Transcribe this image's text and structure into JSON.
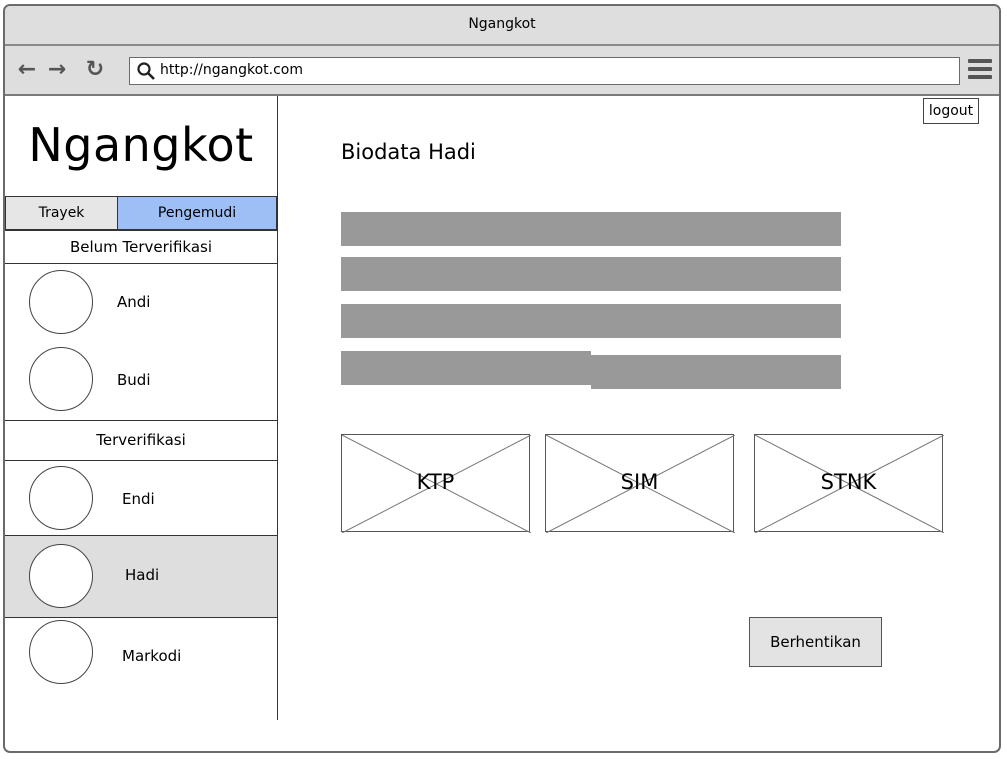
{
  "window": {
    "title": "Ngangkot"
  },
  "browser": {
    "url": "http://ngangkot.com",
    "back_icon": "arrow-left-icon",
    "forward_icon": "arrow-right-icon",
    "reload_icon": "refresh-icon",
    "menu_icon": "hamburger-menu-icon"
  },
  "sidebar": {
    "logo": "Ngangkot",
    "tabs": [
      {
        "label": "Trayek",
        "active": false
      },
      {
        "label": "Pengemudi",
        "active": true
      }
    ],
    "unverified": {
      "header": "Belum Terverifikasi",
      "drivers": [
        {
          "name": "Andi"
        },
        {
          "name": "Budi"
        }
      ]
    },
    "verified": {
      "header": "Terverifikasi",
      "drivers": [
        {
          "name": "Endi"
        },
        {
          "name": "Hadi",
          "selected": true
        },
        {
          "name": "Markodi"
        }
      ]
    }
  },
  "main": {
    "logout_label": "logout",
    "title": "Biodata Hadi",
    "documents": [
      {
        "label": "KTP"
      },
      {
        "label": "SIM"
      },
      {
        "label": "STNK"
      }
    ],
    "stop_button_label": "Berhentikan"
  },
  "colors": {
    "active_tab": "#9dbff5",
    "placeholder_bar": "#999999",
    "selected_row": "#dedede",
    "chrome": "#dedede"
  }
}
